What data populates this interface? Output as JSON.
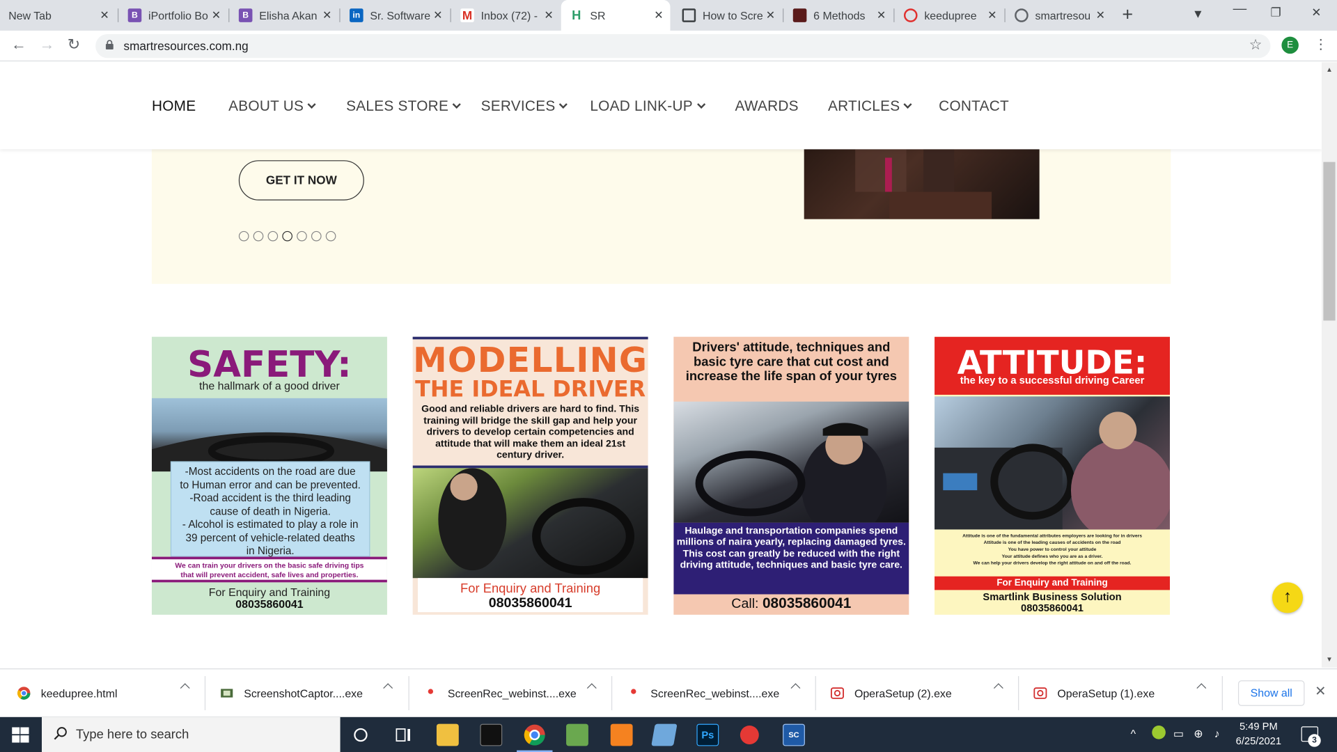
{
  "browser": {
    "tabs": [
      {
        "title": "New Tab",
        "icon": "none"
      },
      {
        "title": "iPortfolio Bo",
        "icon": "bootstrap-icon"
      },
      {
        "title": "Elisha Akan",
        "icon": "bootstrap-icon"
      },
      {
        "title": "Sr. Software",
        "icon": "linkedin-icon"
      },
      {
        "title": "Inbox (72) -",
        "icon": "gmail-icon"
      },
      {
        "title": "SR",
        "icon": "sr-site-icon"
      },
      {
        "title": "How to Scre",
        "icon": "page-icon"
      },
      {
        "title": "6 Methods",
        "icon": "article-icon"
      },
      {
        "title": "keedupree",
        "icon": "opera-icon"
      },
      {
        "title": "smartresou",
        "icon": "globe-icon"
      }
    ],
    "url": "smartresources.com.ng",
    "profile_initial": "E"
  },
  "nav": {
    "items": [
      "HOME",
      "ABOUT US",
      "SALES STORE",
      "SERVICES",
      "LOAD LINK-UP",
      "AWARDS",
      "ARTICLES",
      "CONTACT"
    ]
  },
  "hero": {
    "cta_label": "GET IT NOW",
    "slide_count": 7,
    "active_slide": 4
  },
  "cards": {
    "safety": {
      "title": "SAFETY:",
      "subtitle": "the hallmark of a good driver",
      "points": [
        "-Most accidents on the road are due",
        "to Human error and can be prevented.",
        "-Road accident is the third leading",
        "cause of death in Nigeria.",
        "- Alcohol is estimated to play a role in",
        "39 percent of vehicle-related deaths",
        "in Nigeria."
      ],
      "band_line1": "We can train your drivers on the basic safe driving tips",
      "band_line2": "that will prevent accident, safe lives and properties.",
      "enquiry": "For Enquiry and Training",
      "phone": "08035860041"
    },
    "modelling": {
      "title": "MODELLING",
      "subtitle": "THE IDEAL DRIVER",
      "description": "Good and reliable drivers are hard to find. This training will bridge the skill gap and help your drivers to develop certain competencies and attitude that will make them an ideal 21st century driver.",
      "enquiry": "For Enquiry and Training",
      "phone": "08035860041"
    },
    "tyres": {
      "headline": "Drivers' attitude, techniques and basic tyre care that cut cost and increase the life span of your tyres",
      "band": "Haulage and transportation companies spend millions of naira yearly, replacing damaged tyres. This cost can greatly be reduced with the right driving attitude, techniques and basic tyre care.",
      "call_prefix": "Call:",
      "phone": "08035860041"
    },
    "attitude": {
      "title": "ATTITUDE:",
      "subtitle": "the key to a successful driving Career",
      "fine_print": [
        "Attitude is one of the fundamental attributes employers are looking for in drivers",
        "Attitude is one of the leading causes of accidents on the road",
        "You have power to control your attitude",
        "Your attitude defines who you are as a driver.",
        "We can help your drivers develop the right attitude on and off the road."
      ],
      "enquiry": "For Enquiry and Training",
      "org": "Smartlink Business Solution",
      "phone": "08035860041"
    }
  },
  "downloads": {
    "items": [
      "keedupree.html",
      "ScreenshotCaptor....exe",
      "ScreenRec_webinst....exe",
      "ScreenRec_webinst....exe",
      "OperaSetup (2).exe",
      "OperaSetup (1).exe"
    ],
    "show_all": "Show all"
  },
  "taskbar": {
    "search_placeholder": "Type here to search",
    "time": "5:49 PM",
    "date": "6/25/2021",
    "notification_count": "3"
  }
}
